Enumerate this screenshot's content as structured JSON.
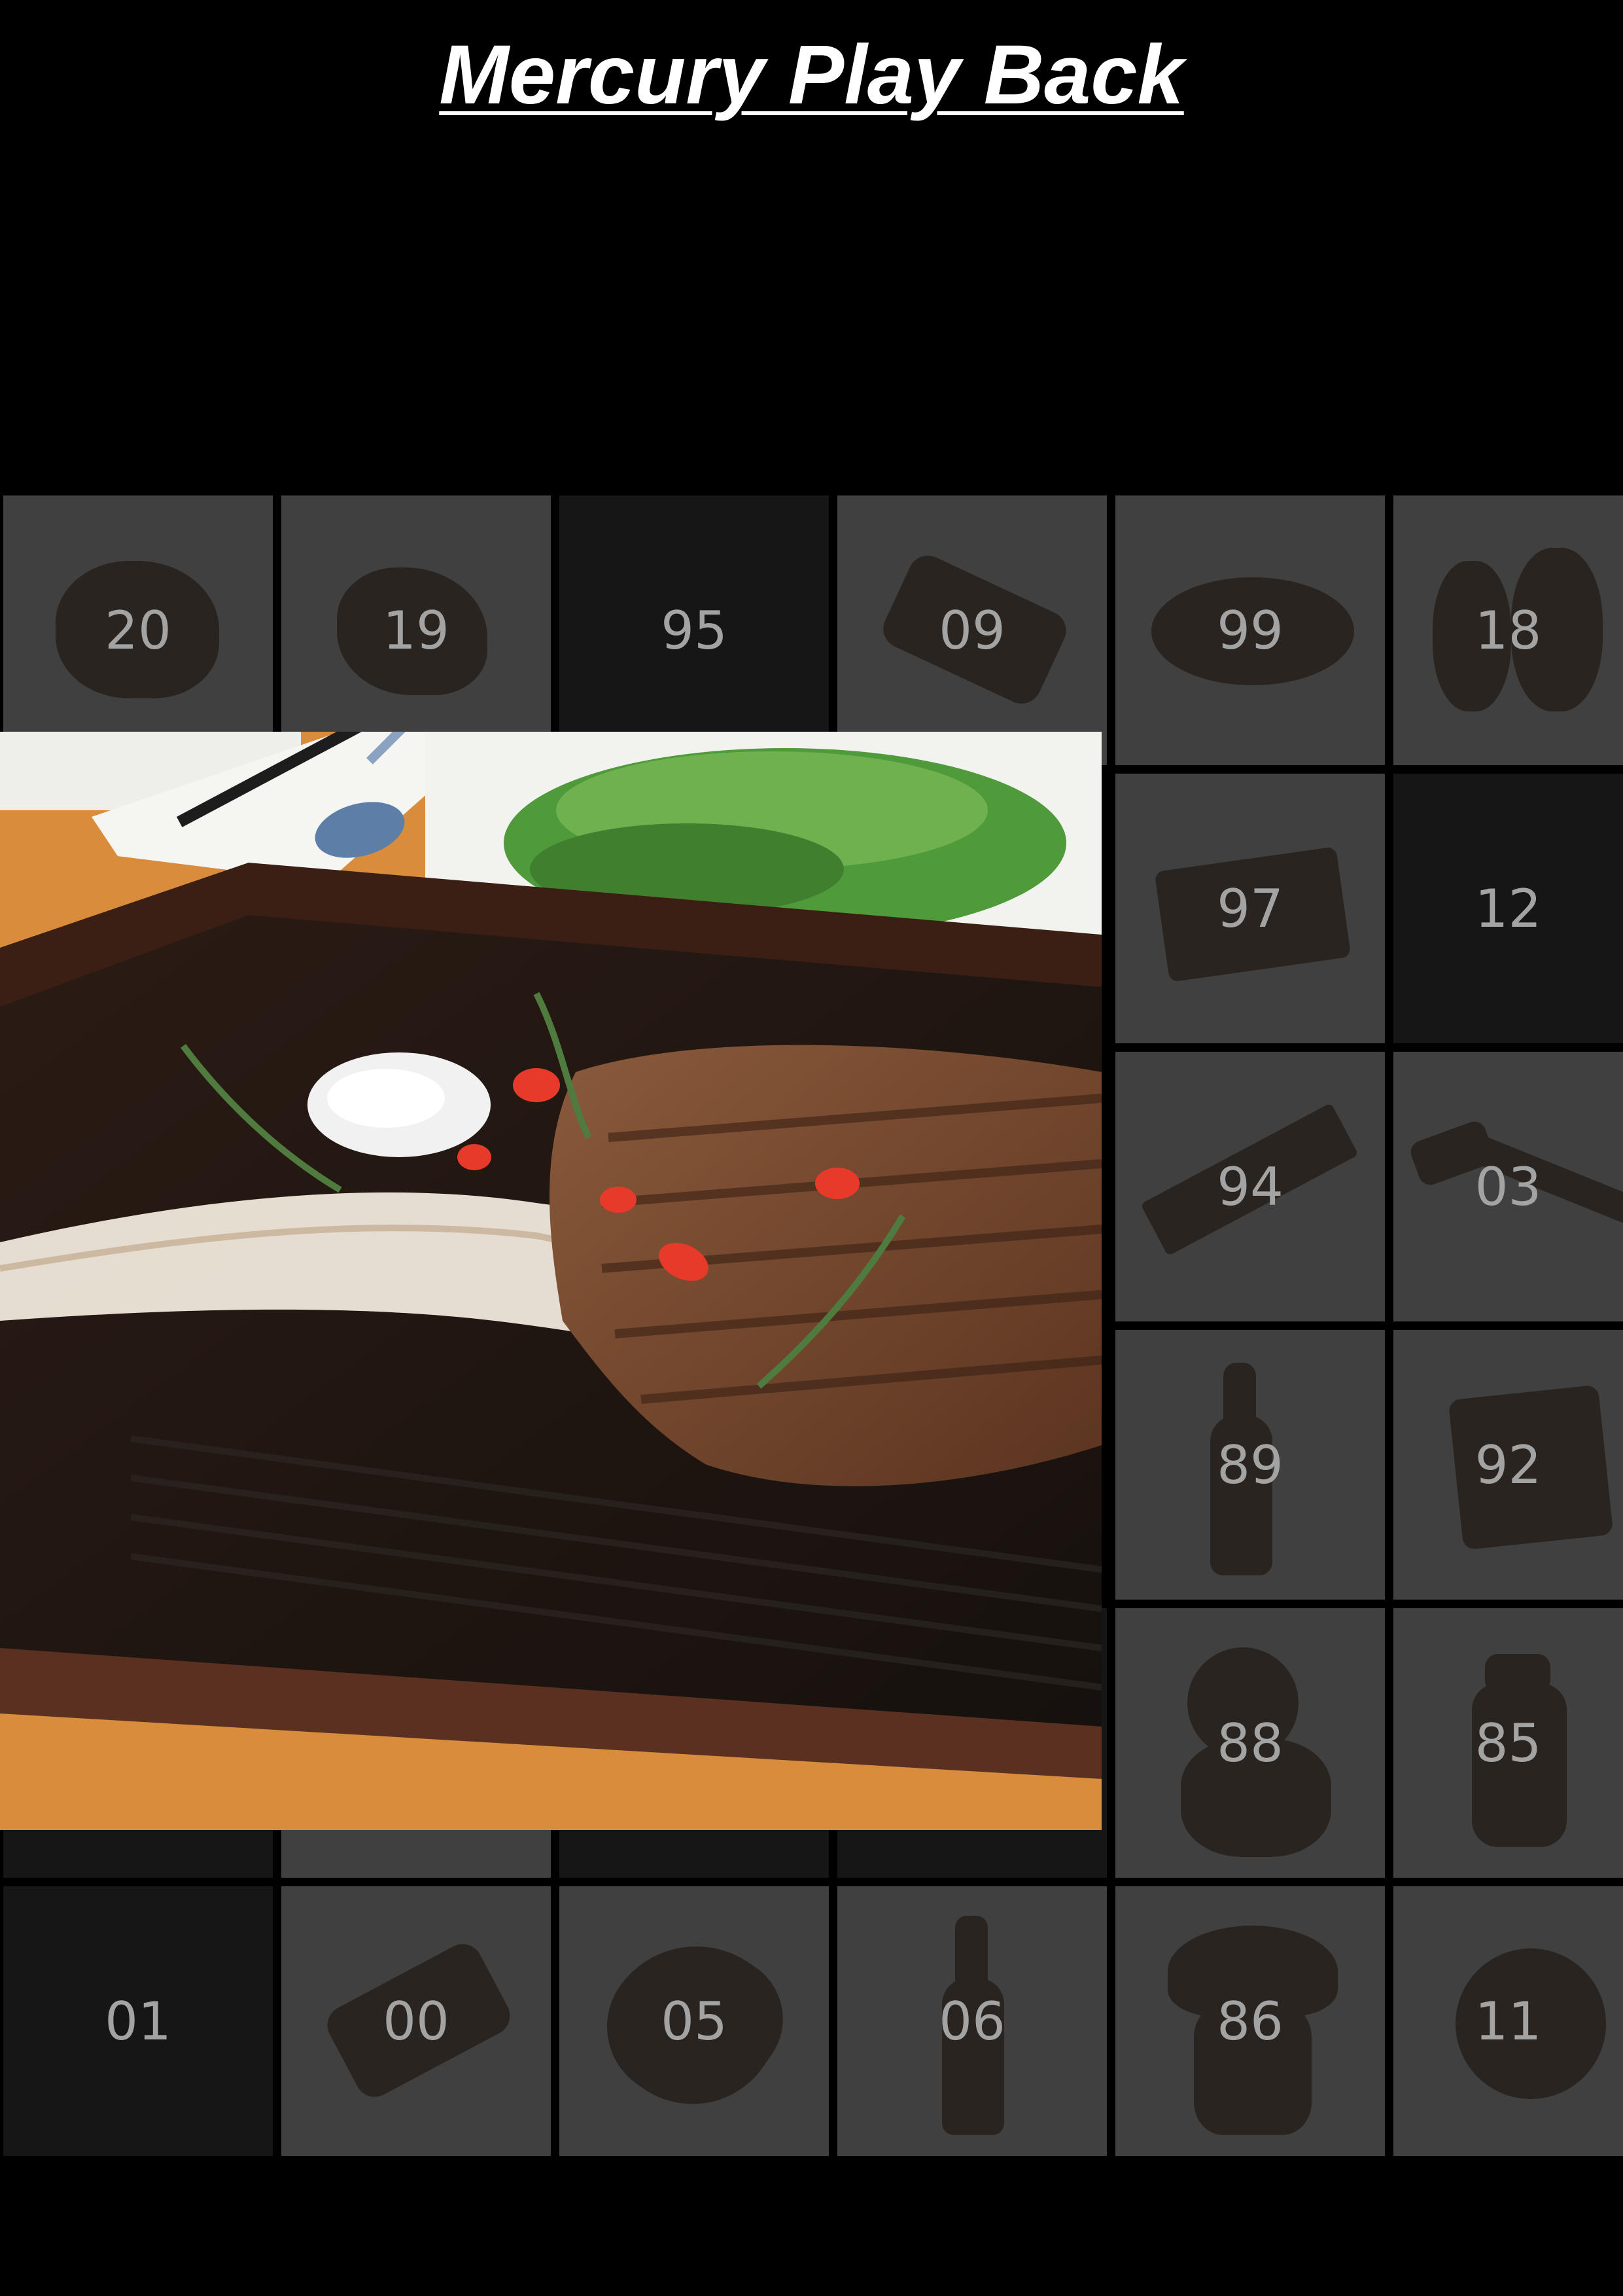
{
  "app": {
    "title": "Mercury Play Back"
  },
  "tiles": [
    {
      "id": "20",
      "label": "20",
      "dark": false,
      "icon": "cushion"
    },
    {
      "id": "19",
      "label": "19",
      "dark": false,
      "icon": "cloth"
    },
    {
      "id": "95",
      "label": "95",
      "dark": true,
      "icon": ""
    },
    {
      "id": "09",
      "label": "09",
      "dark": false,
      "icon": "soap-bar"
    },
    {
      "id": "99",
      "label": "99",
      "dark": false,
      "icon": "loaf"
    },
    {
      "id": "18",
      "label": "18",
      "dark": false,
      "icon": "teddy-bears"
    },
    {
      "id": "97",
      "label": "97",
      "dark": false,
      "icon": "stack"
    },
    {
      "id": "12",
      "label": "12",
      "dark": true,
      "icon": ""
    },
    {
      "id": "94",
      "label": "94",
      "dark": false,
      "icon": "wedge"
    },
    {
      "id": "03",
      "label": "03",
      "dark": false,
      "icon": "hammer"
    },
    {
      "id": "89",
      "label": "89",
      "dark": false,
      "icon": "bottle"
    },
    {
      "id": "92",
      "label": "92",
      "dark": false,
      "icon": "box"
    },
    {
      "id": "88",
      "label": "88",
      "dark": false,
      "icon": "bear-figure"
    },
    {
      "id": "85",
      "label": "85",
      "dark": false,
      "icon": "jar"
    },
    {
      "id": "01",
      "label": "01",
      "dark": true,
      "icon": ""
    },
    {
      "id": "00",
      "label": "00",
      "dark": false,
      "icon": "soap-bar"
    },
    {
      "id": "05",
      "label": "05",
      "dark": false,
      "icon": "shell"
    },
    {
      "id": "06",
      "label": "06",
      "dark": false,
      "icon": "bottle"
    },
    {
      "id": "86",
      "label": "86",
      "dark": false,
      "icon": "plant"
    },
    {
      "id": "11",
      "label": "11",
      "dark": false,
      "icon": "apple"
    }
  ],
  "photo": {
    "subject": "steak-photo",
    "colors": {
      "table": "#d98d3c",
      "board": "#3b1f14",
      "plate": "#f2f2ee",
      "salad": "#4f9a3a",
      "steak": "#7a4a2e"
    }
  }
}
